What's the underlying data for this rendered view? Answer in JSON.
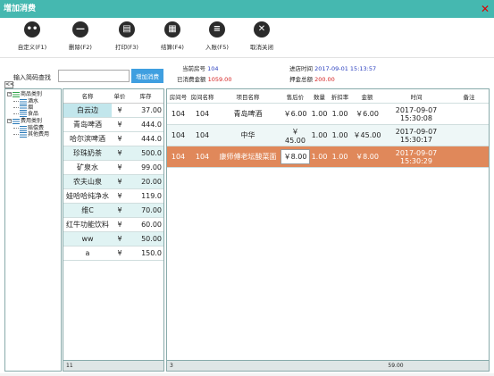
{
  "window": {
    "title": "增加消费",
    "close_glyph": "✕"
  },
  "toolbar": [
    {
      "label": "自定义(F1)",
      "glyph": "••",
      "icon": "dots-icon"
    },
    {
      "label": "删除(F2)",
      "glyph": "—",
      "icon": "minus-icon"
    },
    {
      "label": "打印(F3)",
      "glyph": "▤",
      "icon": "printer-icon"
    },
    {
      "label": "结算(F4)",
      "glyph": "▦",
      "icon": "calculator-icon"
    },
    {
      "label": "入账(F5)",
      "glyph": "≡",
      "icon": "list-icon"
    },
    {
      "label": "取消关闭",
      "glyph": "✕",
      "icon": "cancel-icon"
    }
  ],
  "search": {
    "label": "输入简码查找",
    "value": "",
    "button": "增加消费",
    "collapse_glyph": "<<"
  },
  "tree": [
    {
      "label": "商品类别",
      "level": 0,
      "toggle": "⊟"
    },
    {
      "label": "酒水",
      "level": 1
    },
    {
      "label": "烟",
      "level": 1
    },
    {
      "label": "食品",
      "level": 1
    },
    {
      "label": "费用类别",
      "level": 0,
      "toggle": "⊟"
    },
    {
      "label": "赔偿费",
      "level": 1
    },
    {
      "label": "其他费用",
      "level": 1
    }
  ],
  "products": {
    "headers": [
      "名称",
      "单价",
      "库存"
    ],
    "rows": [
      [
        "白云边",
        "¥",
        "37.00"
      ],
      [
        "青岛啤酒",
        "¥",
        "444.0"
      ],
      [
        "哈尔滨啤酒",
        "¥",
        "444.0"
      ],
      [
        "珍珠奶茶",
        "¥",
        "500.0"
      ],
      [
        "矿泉水",
        "¥",
        "99.00"
      ],
      [
        "农夫山泉",
        "¥",
        "20.00"
      ],
      [
        "娃哈哈纯净水",
        "¥",
        "119.0"
      ],
      [
        "维C",
        "¥",
        "70.00"
      ],
      [
        "红牛功能饮料",
        "¥",
        "60.00"
      ],
      [
        "ww",
        "¥",
        "50.00"
      ],
      [
        "a",
        "¥",
        "150.0"
      ]
    ],
    "footer_count": "11"
  },
  "info": {
    "room_label": "当前房号",
    "room_value": "104",
    "time_label": "进店时间",
    "time_value": "2017-09-01 15:13:57",
    "total_label": "已消费金额",
    "total_value": "1059.00",
    "deposit_label": "押金总额",
    "deposit_value": "200.00"
  },
  "orders": {
    "headers": [
      "房间号",
      "房间名称",
      "项目名称",
      "售后价",
      "数量",
      "折扣率",
      "金额",
      "时间",
      "备注"
    ],
    "rows": [
      [
        "104",
        "104",
        "青岛啤酒",
        "￥6.00",
        "1.00",
        "1.00",
        "￥6.00",
        "2017-09-07 15:30:08",
        ""
      ],
      [
        "104",
        "104",
        "中华",
        "￥ 45.00",
        "1.00",
        "1.00",
        "￥45.00",
        "2017-09-07 15:30:17",
        ""
      ],
      [
        "104",
        "104",
        "康师傅老坛酸菜面",
        "￥8.00",
        "1.00",
        "1.00",
        "￥8.00",
        "2017-09-07 15:30:29",
        ""
      ]
    ],
    "footer_count": "3",
    "footer_total": "59.00"
  },
  "colors": {
    "titlebar": "#45b8b0",
    "selected_row": "#e0885a",
    "accent_button": "#3f9fe0",
    "value_blue": "#2a3fbf",
    "value_red": "#d42020"
  }
}
